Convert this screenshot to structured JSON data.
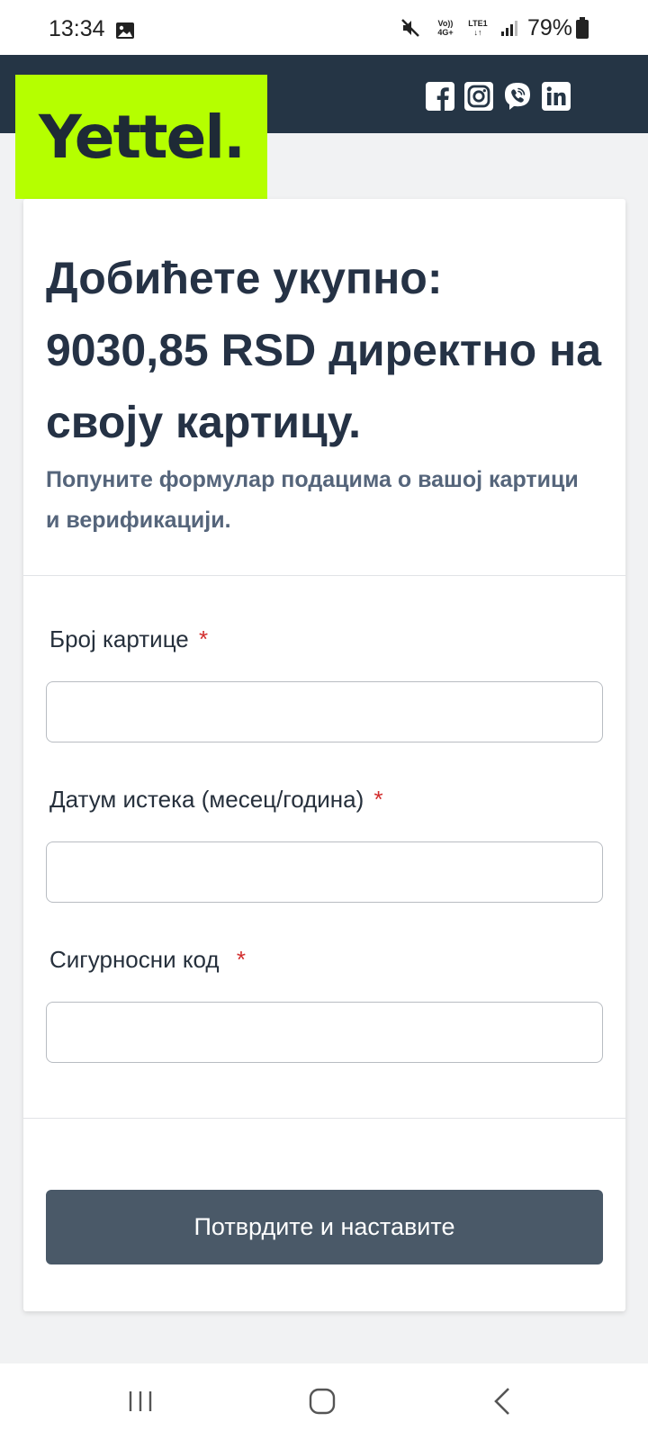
{
  "status_bar": {
    "time": "13:34",
    "network_top": "Vo)) 4G+",
    "network_bottom": "LTE1 ↓↑",
    "battery": "79%",
    "icons": [
      "gallery-icon",
      "mute-icon",
      "signal-icon",
      "battery-icon"
    ]
  },
  "header": {
    "logo": "Yettel.",
    "logo_color": "#b5ff00",
    "background": "#253545",
    "social_icons": [
      "facebook-icon",
      "instagram-icon",
      "viber-icon",
      "linkedin-icon"
    ]
  },
  "card": {
    "headline": "Добићете укупно: 9030,85 RSD директно на своју картицу.",
    "subtitle": "Попуните формулар подацима о вашој картици и верификацији.",
    "fields": [
      {
        "label": "Број картице",
        "required_mark": "*",
        "value": ""
      },
      {
        "label": "Датум истека (месец/година)",
        "required_mark": "*",
        "value": ""
      },
      {
        "label": "Сигурносни код",
        "required_mark": "*",
        "value": ""
      }
    ],
    "submit_label": "Потврдите и наставите",
    "submit_color": "#4a5968"
  },
  "nav_bar": {
    "buttons": [
      "recent-apps-icon",
      "home-icon",
      "back-icon"
    ]
  }
}
